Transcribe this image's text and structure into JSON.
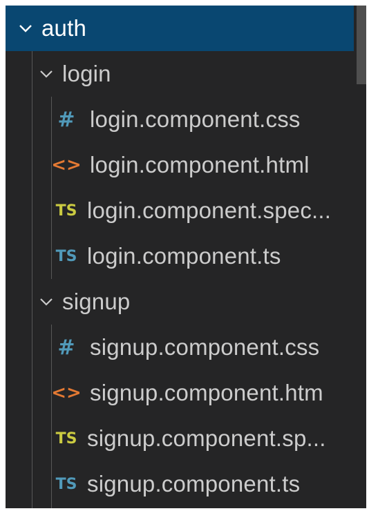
{
  "explorer": {
    "folder": {
      "name": "auth",
      "expanded": true,
      "selected": true,
      "children": [
        {
          "name": "login",
          "expanded": true,
          "files": [
            {
              "name": "login.component.css",
              "icon": "css-hash-icon",
              "glyph": "#"
            },
            {
              "name": "login.component.html",
              "icon": "html-brackets-icon",
              "glyph": "<>"
            },
            {
              "name": "login.component.spec...",
              "icon": "typescript-spec-icon",
              "glyph": "TS"
            },
            {
              "name": "login.component.ts",
              "icon": "typescript-icon",
              "glyph": "TS"
            }
          ]
        },
        {
          "name": "signup",
          "expanded": true,
          "files": [
            {
              "name": "signup.component.css",
              "icon": "css-hash-icon",
              "glyph": "#"
            },
            {
              "name": "signup.component.htm",
              "icon": "html-brackets-icon",
              "glyph": "<>"
            },
            {
              "name": "signup.component.sp...",
              "icon": "typescript-spec-icon",
              "glyph": "TS"
            },
            {
              "name": "signup.component.ts",
              "icon": "typescript-icon",
              "glyph": "TS"
            }
          ]
        }
      ]
    },
    "colors": {
      "background": "#252526",
      "selection": "#094771",
      "text": "#cccccc",
      "css_icon": "#519aba",
      "html_icon": "#e37933",
      "ts_spec_icon": "#cbcb41",
      "ts_icon": "#519aba"
    }
  }
}
